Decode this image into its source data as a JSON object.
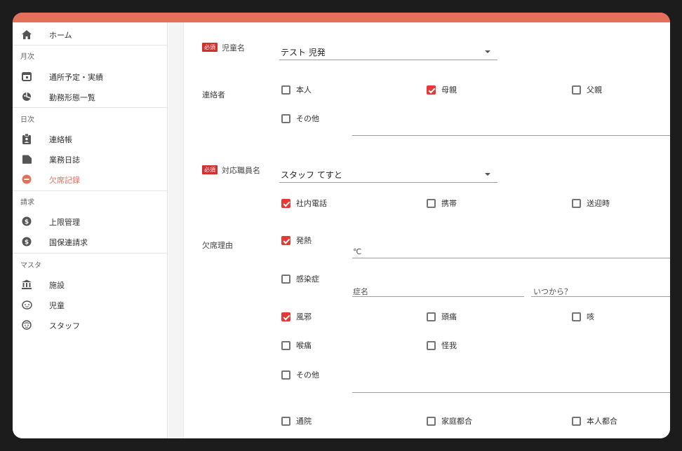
{
  "sidebar": {
    "home": "ホーム",
    "sections": {
      "monthly": "月次",
      "daily": "日次",
      "billing": "請求",
      "master": "マスタ"
    },
    "items": [
      {
        "label": "通所予定・実績",
        "icon": "calendar-icon"
      },
      {
        "label": "勤務形態一覧",
        "icon": "pie-chart-icon"
      },
      {
        "label": "連絡帳",
        "icon": "clipboard-icon"
      },
      {
        "label": "業務日誌",
        "icon": "folder-icon"
      },
      {
        "label": "欠席記録",
        "icon": "minus-circle-icon"
      },
      {
        "label": "上限管理",
        "icon": "dollar-icon"
      },
      {
        "label": "国保連請求",
        "icon": "dollar-icon"
      },
      {
        "label": "施設",
        "icon": "bank-icon"
      },
      {
        "label": "児童",
        "icon": "child-face-icon"
      },
      {
        "label": "スタッフ",
        "icon": "face-icon"
      }
    ]
  },
  "form": {
    "required_badge": "必須",
    "child_label": "児童名",
    "child_value": "テスト 児発",
    "contact_label": "連絡者",
    "contact_options": [
      {
        "label": "本人",
        "checked": false
      },
      {
        "label": "母親",
        "checked": true
      },
      {
        "label": "父親",
        "checked": false
      },
      {
        "label": "その他",
        "checked": false
      }
    ],
    "staff_label": "対応職員名",
    "staff_value": "スタッフ てすと",
    "method_options": [
      {
        "label": "社内電話",
        "checked": true
      },
      {
        "label": "携帯",
        "checked": false
      },
      {
        "label": "送迎時",
        "checked": false
      }
    ],
    "reason_label": "欠席理由",
    "fever": {
      "label": "発熱",
      "checked": true
    },
    "temp_placeholder": "℃",
    "infection": {
      "label": "感染症",
      "checked": false
    },
    "disease_placeholder": "症名",
    "since_placeholder": "いつから？",
    "symptoms": [
      {
        "label": "風邪",
        "checked": true
      },
      {
        "label": "頭痛",
        "checked": false
      },
      {
        "label": "咳",
        "checked": false
      },
      {
        "label": "喉痛",
        "checked": false
      },
      {
        "label": "怪我",
        "checked": false
      },
      {
        "label": "その他",
        "checked": false
      }
    ],
    "others": [
      {
        "label": "通院",
        "checked": false
      },
      {
        "label": "家庭都合",
        "checked": false
      },
      {
        "label": "本人都合",
        "checked": false
      }
    ]
  },
  "colors": {
    "accent": "#e5705a",
    "checkbox": "#e53935",
    "required": "#d32f2f"
  }
}
